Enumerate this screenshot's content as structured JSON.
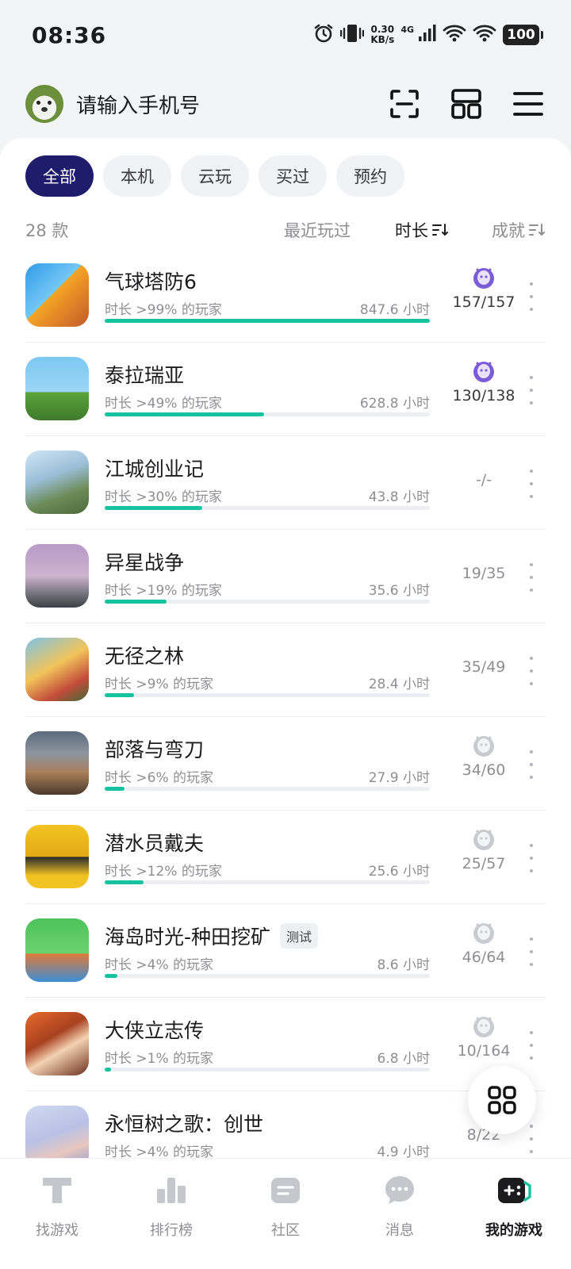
{
  "status": {
    "time": "08:36",
    "net_speed_value": "0.30",
    "net_speed_unit": "KB/s",
    "signal_label": "4G",
    "battery": "100"
  },
  "header": {
    "title": "请输入手机号",
    "icons": [
      "scan-icon",
      "layout-icon",
      "menu-icon"
    ]
  },
  "filters": {
    "chips": [
      "全部",
      "本机",
      "云玩",
      "买过",
      "预约"
    ],
    "active_index": 0
  },
  "sort": {
    "count": "28 款",
    "recent": "最近玩过",
    "duration": "时长",
    "achievement": "成就",
    "active": "duration"
  },
  "games": [
    {
      "name": "气球塔防6",
      "percentile": "时长 >99% 的玩家",
      "hours": "847.6 小时",
      "achievement": "157/157",
      "badge": "purple",
      "progress": 1.0,
      "tag": ""
    },
    {
      "name": "泰拉瑞亚",
      "percentile": "时长 >49% 的玩家",
      "hours": "628.8 小时",
      "achievement": "130/138",
      "badge": "purple",
      "progress": 0.49,
      "tag": ""
    },
    {
      "name": "江城创业记",
      "percentile": "时长 >30% 的玩家",
      "hours": "43.8 小时",
      "achievement": "-/-",
      "badge": "none",
      "progress": 0.3,
      "tag": ""
    },
    {
      "name": "异星战争",
      "percentile": "时长 >19% 的玩家",
      "hours": "35.6 小时",
      "achievement": "19/35",
      "badge": "none",
      "progress": 0.19,
      "tag": ""
    },
    {
      "name": "无径之林",
      "percentile": "时长 >9% 的玩家",
      "hours": "28.4 小时",
      "achievement": "35/49",
      "badge": "none",
      "progress": 0.09,
      "tag": ""
    },
    {
      "name": "部落与弯刀",
      "percentile": "时长 >6% 的玩家",
      "hours": "27.9 小时",
      "achievement": "34/60",
      "badge": "grey",
      "progress": 0.06,
      "tag": ""
    },
    {
      "name": "潜水员戴夫",
      "percentile": "时长 >12% 的玩家",
      "hours": "25.6 小时",
      "achievement": "25/57",
      "badge": "grey",
      "progress": 0.12,
      "tag": ""
    },
    {
      "name": "海岛时光-种田挖矿",
      "percentile": "时长 >4% 的玩家",
      "hours": "8.6 小时",
      "achievement": "46/64",
      "badge": "grey",
      "progress": 0.04,
      "tag": "测试"
    },
    {
      "name": "大侠立志传",
      "percentile": "时长 >1% 的玩家",
      "hours": "6.8 小时",
      "achievement": "10/164",
      "badge": "grey",
      "progress": 0.01,
      "tag": ""
    },
    {
      "name": "永恒树之歌：创世",
      "percentile": "时长 >4% 的玩家",
      "hours": "4.9 小时",
      "achievement": "8/22",
      "badge": "none",
      "progress": 0.04,
      "tag": ""
    }
  ],
  "nav": {
    "items": [
      {
        "label": "找游戏",
        "icon": "find-game-icon"
      },
      {
        "label": "排行榜",
        "icon": "ranking-icon"
      },
      {
        "label": "社区",
        "icon": "community-icon"
      },
      {
        "label": "消息",
        "icon": "message-icon"
      },
      {
        "label": "我的游戏",
        "icon": "my-games-icon"
      }
    ],
    "active_index": 4
  },
  "colors": {
    "accent": "#16c3a0",
    "chip_active": "#1f1c6b",
    "badge_purple": "#7b5bd6"
  }
}
